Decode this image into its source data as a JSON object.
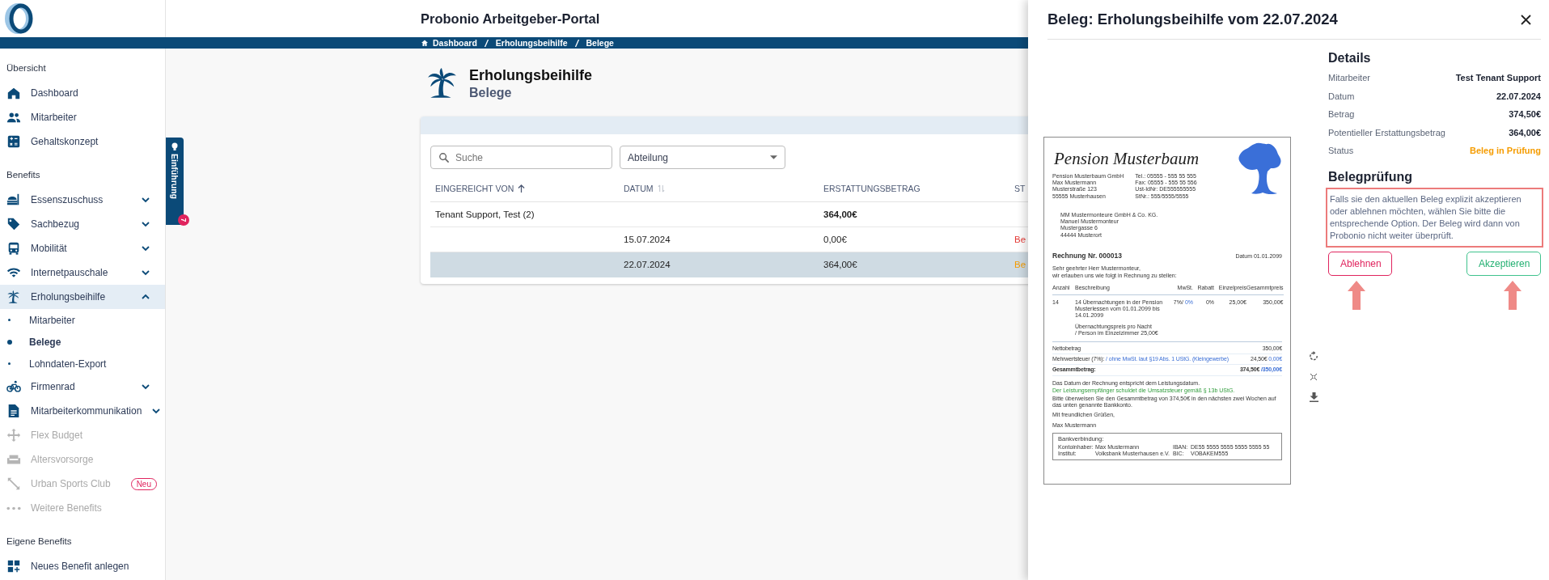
{
  "header": {
    "title": "Probonio Arbeitgeber-Portal",
    "breadcrumb": [
      "Dashboard",
      "Erholungsbeihilfe",
      "Belege"
    ]
  },
  "sidebar": {
    "sections": [
      {
        "heading": "Übersicht",
        "items": [
          {
            "label": "Dashboard",
            "kind": "link",
            "selected": false,
            "disabled": false
          },
          {
            "label": "Mitarbeiter",
            "kind": "link",
            "selected": false,
            "disabled": false
          },
          {
            "label": "Gehaltskonzept",
            "kind": "link",
            "selected": false,
            "disabled": false
          }
        ]
      },
      {
        "heading": "Benefits",
        "items": [
          {
            "label": "Essenszuschuss",
            "kind": "group",
            "expanded": false,
            "selected": false,
            "disabled": false
          },
          {
            "label": "Sachbezug",
            "kind": "group",
            "expanded": false,
            "selected": false,
            "disabled": false
          },
          {
            "label": "Mobilität",
            "kind": "group",
            "expanded": false,
            "selected": false,
            "disabled": false
          },
          {
            "label": "Internetpauschale",
            "kind": "group",
            "expanded": false,
            "selected": false,
            "disabled": false
          },
          {
            "label": "Erholungsbeihilfe",
            "kind": "group",
            "expanded": true,
            "selected": true,
            "disabled": false,
            "children": [
              {
                "label": "Mitarbeiter",
                "kind": "sub",
                "selected": false
              },
              {
                "label": "Belege",
                "kind": "sub",
                "selected": true
              },
              {
                "label": "Lohndaten-Export",
                "kind": "sub",
                "selected": false
              }
            ]
          },
          {
            "label": "Firmenrad",
            "kind": "group",
            "expanded": false,
            "selected": false,
            "disabled": false
          },
          {
            "label": "Mitarbeiterkommunikation",
            "kind": "group",
            "expanded": false,
            "selected": false,
            "disabled": false
          },
          {
            "label": "Flex Budget",
            "kind": "link",
            "selected": false,
            "disabled": true
          },
          {
            "label": "Altersvorsorge",
            "kind": "link",
            "selected": false,
            "disabled": true
          },
          {
            "label": "Urban Sports Club",
            "kind": "link",
            "selected": false,
            "disabled": true,
            "badge": "Neu"
          },
          {
            "label": "Weitere Benefits",
            "kind": "link",
            "selected": false,
            "disabled": true
          }
        ]
      },
      {
        "heading": "Eigene Benefits",
        "items": [
          {
            "label": "Neues Benefit anlegen",
            "kind": "link",
            "selected": false,
            "disabled": false
          }
        ]
      }
    ]
  },
  "intro_tab": {
    "label": "Einführung",
    "badge": "7"
  },
  "page": {
    "title": "Erholungsbeihilfe",
    "subtitle": "Belege"
  },
  "table": {
    "search": {
      "placeholder": "Suche"
    },
    "filter": {
      "value": "Abteilung"
    },
    "columns": [
      {
        "label": "EINGEREICHT VON",
        "sorted": true
      },
      {
        "label": "DATUM",
        "sorted": false
      },
      {
        "label": "ERSTATTUNGSBETRAG"
      },
      {
        "label": "ST"
      }
    ],
    "rows": [
      {
        "kind": "group",
        "name": "Tenant Support, Test (2)",
        "date": "",
        "amount": "364,00€",
        "status": "",
        "selected": false
      },
      {
        "kind": "entry",
        "name": "",
        "date": "15.07.2024",
        "amount": "0,00€",
        "status": "Be",
        "color": "#e53935",
        "selected": false
      },
      {
        "kind": "entry",
        "name": "",
        "date": "22.07.2024",
        "amount": "364,00€",
        "status": "Be",
        "color": "#f59c00",
        "selected": true
      }
    ]
  },
  "drawer": {
    "title": "Beleg: Erholungsbeihilfe vom 22.07.2024",
    "details": {
      "heading": "Details",
      "rows": [
        {
          "label": "Mitarbeiter",
          "value": "Test Tenant Support",
          "kind": "plain"
        },
        {
          "label": "Datum",
          "value": "22.07.2024",
          "kind": "plain"
        },
        {
          "label": "Betrag",
          "value": "374,50€",
          "kind": "plain"
        },
        {
          "label": "Potentieller Erstattungsbetrag",
          "value": "364,00€",
          "kind": "plain"
        },
        {
          "label": "Status",
          "value": "Beleg in Prüfung",
          "kind": "status"
        }
      ]
    },
    "review": {
      "heading": "Belegprüfung",
      "text": "Falls sie den aktuellen Beleg explizit akzeptieren oder ablehnen möchten, wählen Sie bitte die entsprechende Option. Der Beleg wird dann von Probonio nicht weiter überprüft.",
      "annotated": true,
      "buttons": [
        {
          "label": "Ablehnen",
          "kind": "reject"
        },
        {
          "label": "Akzeptieren",
          "kind": "accept"
        }
      ]
    },
    "document": {
      "logo_text": "Pension Musterbaum",
      "sender_lines": [
        "Pension Musterbaum GmbH",
        "Max Mustermann",
        "Musterstraße 123",
        "55555 Musterhausen"
      ],
      "contact_lines": [
        "Tel.: 05555 - 555 55 555",
        "Fax: 05555 - 555 55 556",
        "Ust-IdNr: DE555555555",
        "StNr.: 555/5555/5555"
      ],
      "recipient_lines": [
        "MM Mustermonteure GmbH & Co. KG.",
        "Manuel Mustermonteur",
        "Mustergasse 6",
        "44444 Musterort"
      ],
      "invoice_title": "Rechnung Nr. 000013",
      "invoice_date": "Datum 01.01.2099",
      "salutation": [
        "Sehr geehrter Herr Mustermonteur,",
        "wir erlauben uns wie folgt in Rechnung zu stellen:"
      ],
      "columns": [
        "Anzahl",
        "Beschreibung",
        "MwSt.",
        "Rabatt",
        "Einzelpreis",
        "Gesammtpreis"
      ],
      "item": {
        "qty": "14",
        "desc": "14 Übernachtungen in der Pension",
        "detail": "Musterlessen vom 01.01.2099 bis",
        "detail_date": "14.01.2099",
        "vat": "7%/",
        "vat_alt": "0%",
        "discount": "0%",
        "unit": "25,00€",
        "total": "350,00€",
        "note": "Übernachtungspreis pro Nacht",
        "note_2": "/ Person im Einzelzimmer 25,00€"
      },
      "net": {
        "label": "Nettobetrag",
        "value": "350,00€"
      },
      "vat_row": {
        "label": "Mehrwertsteuer (7%):",
        "alt": "/ ohne MwSt. laut §19 Abs. 1 UStG. (Kleingewerbe)",
        "value": "24,50€",
        "value_alt": "0,00€"
      },
      "total_row": {
        "label": "Gesammtbetrag:",
        "value": "374,50€",
        "value_alt": "/350,00€"
      },
      "footer_lines": [
        {
          "text": "Das Datum der Rechnung entspricht dem Leistungsdatum.",
          "kind": "plain"
        },
        {
          "text": "Der Leistungsempfänger schuldet die Umsatzsteuer gemäß § 13b UStG.",
          "kind": "green"
        },
        {
          "text": "Bitte überweisen Sie den Gesammtbetrag von 374,50€ in den nächsten zwei Wochen auf das unten genannte Bankkonto.",
          "kind": "plain"
        },
        {
          "text": "Mit freundlichen Grüßen,",
          "kind": "gap"
        },
        {
          "text": "Max Mustermann",
          "kind": "gap"
        }
      ],
      "bank": {
        "heading": "Bankverbindung:",
        "rows": [
          [
            "Kontoinhaber:",
            "Max Mustermann",
            "IBAN:",
            "DE55 5555 5555 5555 5555 55"
          ],
          [
            "Institut:",
            "Volksbank Musterhausen e.V.",
            "BIC:",
            "VOBAKEM555"
          ]
        ]
      }
    }
  }
}
